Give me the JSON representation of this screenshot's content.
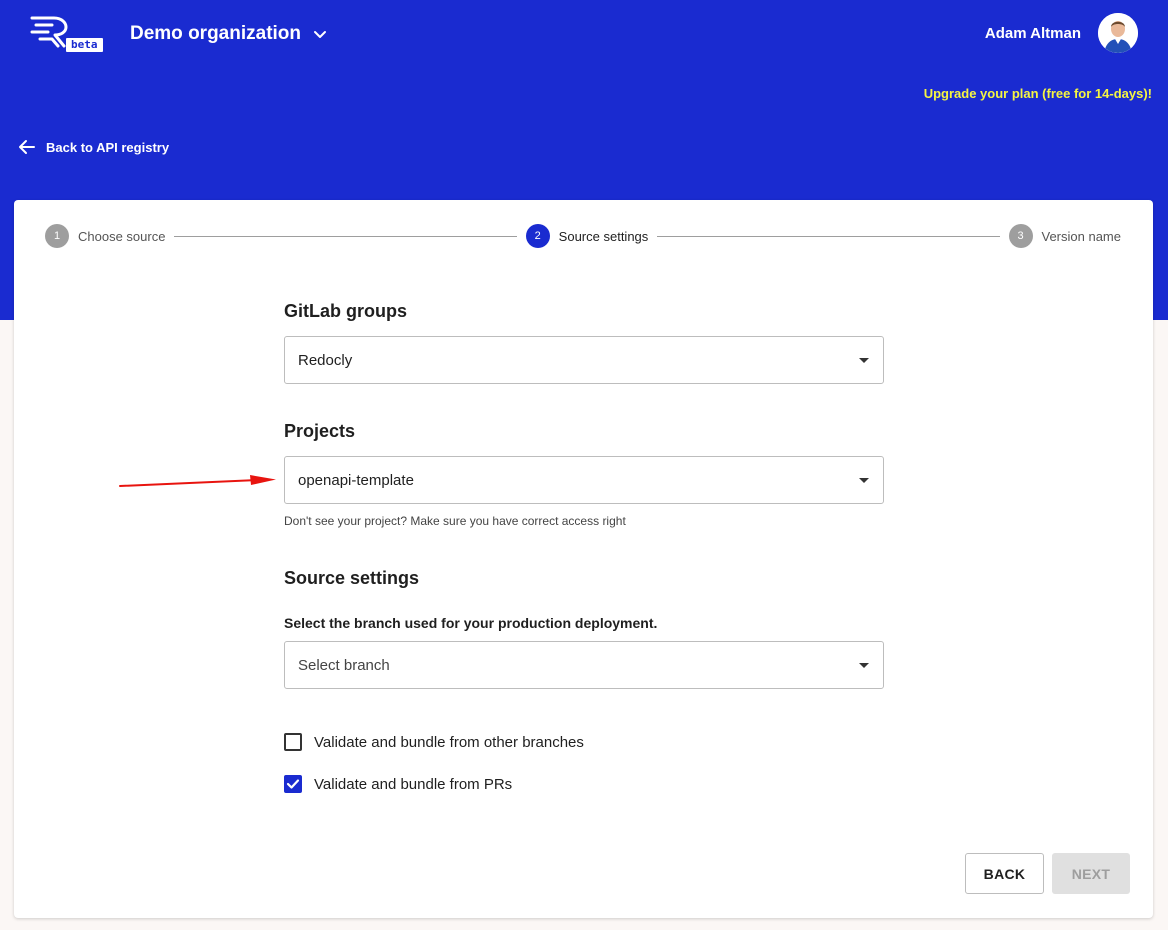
{
  "header": {
    "logo_badge": "beta",
    "org_name": "Demo organization",
    "user_name": "Adam Altman",
    "upgrade_text": "Upgrade your plan (free for 14-days)!",
    "back_link": "Back to API registry"
  },
  "stepper": {
    "steps": [
      {
        "number": "1",
        "label": "Choose source",
        "state": "inactive"
      },
      {
        "number": "2",
        "label": "Source settings",
        "state": "active"
      },
      {
        "number": "3",
        "label": "Version name",
        "state": "inactive"
      }
    ]
  },
  "form": {
    "gitlab_groups": {
      "title": "GitLab groups",
      "value": "Redocly"
    },
    "projects": {
      "title": "Projects",
      "value": "openapi-template",
      "hint": "Don't see your project? Make sure you have correct access right"
    },
    "source_settings": {
      "title": "Source settings",
      "branch_label": "Select the branch used for your production deployment.",
      "branch_placeholder": "Select branch"
    },
    "checkboxes": [
      {
        "label": "Validate and bundle from other branches",
        "checked": false
      },
      {
        "label": "Validate and bundle from PRs",
        "checked": true
      }
    ]
  },
  "actions": {
    "back_label": "BACK",
    "next_label": "NEXT"
  },
  "colors": {
    "brand_blue": "#1a2bd0",
    "upgrade_yellow": "#f5f542",
    "annotation_red": "#e8140f"
  }
}
